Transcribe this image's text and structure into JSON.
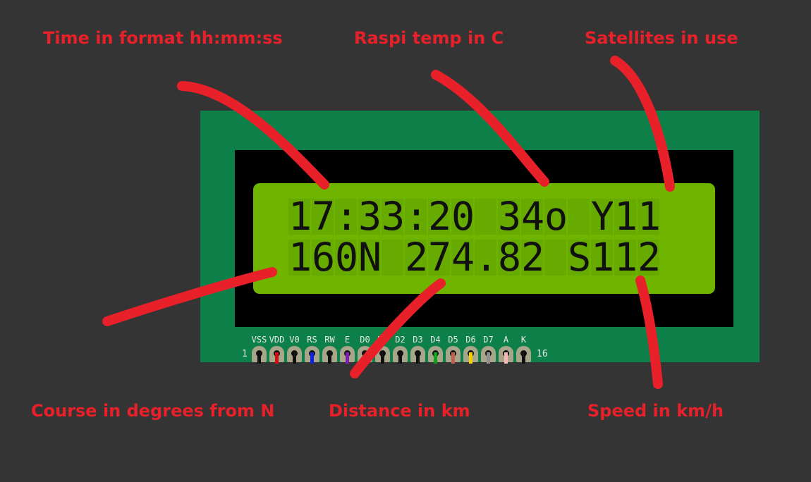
{
  "annotations": {
    "time": "Time in format hh:mm:ss",
    "temp": "Raspi temp in C",
    "satellites": "Satellites in use",
    "course": "Course in degrees from N",
    "distance": "Distance in km",
    "speed": "Speed in km/h"
  },
  "lcd": {
    "line1": "17:33:20 34o Y11",
    "line2": "160N 274.82 S112"
  },
  "pins": {
    "first_number": "1",
    "last_number": "16",
    "labels": [
      "VSS",
      "VDD",
      "V0",
      "RS",
      "RW",
      "E",
      "D0",
      "D1",
      "D2",
      "D3",
      "D4",
      "D5",
      "D6",
      "D7",
      "A",
      "K"
    ],
    "wire_colors": [
      "#111111",
      "#d01010",
      "#111111",
      "#1020e0",
      "#111111",
      "#8020b0",
      "#111111",
      "#111111",
      "#111111",
      "#111111",
      "#10a020",
      "#c06050",
      "#f0d000",
      "#909090",
      "#f4b8b8",
      "#111111"
    ]
  },
  "colors": {
    "background": "#343434",
    "board": "#0c8048",
    "screen": "#6fb500",
    "annotation": "#e8202a"
  }
}
